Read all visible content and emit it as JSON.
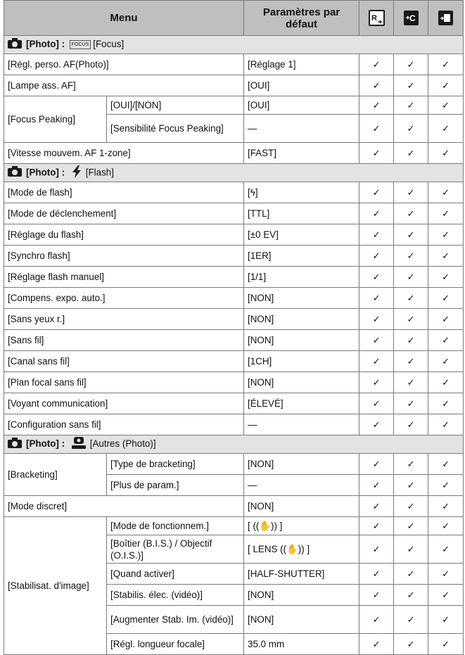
{
  "header": {
    "menu": "Menu",
    "defaults": "Paramètres par défaut"
  },
  "sections": {
    "focus": {
      "photo": "[Photo] :",
      "icon_text": "FOCUS",
      "title": "[Focus]"
    },
    "flash": {
      "photo": "[Photo] :",
      "title": "[Flash]"
    },
    "autres": {
      "photo": "[Photo] :",
      "title": "[Autres (Photo)]"
    }
  },
  "rows": {
    "af_perso": {
      "menu": "[Régl. perso. AF(Photo)]",
      "value": "[Réglage 1]"
    },
    "lampe": {
      "menu": "[Lampe ass. AF]",
      "value": "[OUI]"
    },
    "peaking": {
      "menu": "[Focus Peaking]",
      "sub1": "[OUI]/[NON]",
      "val1": "[OUI]",
      "sub2": "[Sensibilité Focus Peaking]",
      "val2": "—"
    },
    "vitesse": {
      "menu": "[Vitesse mouvem. AF 1-zone]",
      "value": "[FAST]"
    },
    "flash_rows": [
      {
        "menu": "[Mode de flash]",
        "value": "[ϟ]"
      },
      {
        "menu": "[Mode de déclenchement]",
        "value": "[TTL]"
      },
      {
        "menu": "[Réglage du flash]",
        "value": "[±0 EV]"
      },
      {
        "menu": "[Synchro flash]",
        "value": "[1ER]"
      },
      {
        "menu": "[Réglage flash manuel]",
        "value": "[1/1]"
      },
      {
        "menu": "[Compens. expo. auto.]",
        "value": "[NON]"
      },
      {
        "menu": "[Sans yeux r.]",
        "value": "[NON]"
      },
      {
        "menu": "[Sans fil]",
        "value": "[NON]"
      },
      {
        "menu": "[Canal sans fil]",
        "value": "[1CH]"
      },
      {
        "menu": "[Plan focal sans fil]",
        "value": "[NON]"
      },
      {
        "menu": "[Voyant communication]",
        "value": "[ÉLEVÉ]"
      },
      {
        "menu": "[Configuration sans fil]",
        "value": "—"
      }
    ],
    "bracketing": {
      "menu": "[Bracketing]",
      "sub1": "[Type de bracketing]",
      "val1": "[NON]",
      "sub2": "[Plus de param.]",
      "val2": "—"
    },
    "discret": {
      "menu": "[Mode discret]",
      "value": "[NON]"
    },
    "stab": {
      "menu": "[Stabilisat. d'image]",
      "subs": [
        {
          "sub": "[Mode de fonctionnem.]",
          "value": "[ ((✋)) ]"
        },
        {
          "sub": "[Boîtier (B.I.S.) / Objectif (O.I.S.)]",
          "value": "[ LENS ((✋)) ]"
        },
        {
          "sub": "[Quand activer]",
          "value": "[HALF-SHUTTER]"
        },
        {
          "sub": "[Stabilis. élec. (vidéo)]",
          "value": "[NON]"
        },
        {
          "sub": "[Augmenter Stab. Im. (vidéo)]",
          "value": "[NON]"
        },
        {
          "sub": "[Régl. longueur focale]",
          "value": "35.0 mm"
        }
      ]
    }
  },
  "check": "✓",
  "icons": {
    "camera": "camera-icon",
    "reset": "reset-icon",
    "custom": "custom-icon",
    "copy": "copy-icon",
    "flash": "flash-icon",
    "other": "other-icon"
  }
}
